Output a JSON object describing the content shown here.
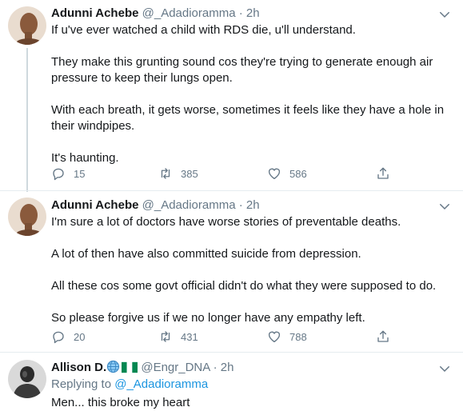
{
  "tweets": [
    {
      "name": "Adunni Achebe",
      "handle": "@_Adadioramma",
      "dot": "·",
      "time": "2h",
      "paragraphs": [
        "If u've ever watched a child with RDS die, u'll understand.",
        "They make this grunting sound cos they're trying to generate enough air pressure to keep their lungs open.",
        "With each breath, it gets worse, sometimes it feels like they have a hole in their windpipes.",
        "It's haunting."
      ],
      "replies": "15",
      "retweets": "385",
      "likes": "586"
    },
    {
      "name": "Adunni Achebe",
      "handle": "@_Adadioramma",
      "dot": "·",
      "time": "2h",
      "paragraphs": [
        "I'm sure a lot of doctors have worse stories of preventable deaths.",
        "A lot of then have also committed suicide from depression.",
        "All these cos some govt official didn't do what they were supposed to do.",
        "So please forgive us if we no longer have any empathy left."
      ],
      "replies": "20",
      "retweets": "431",
      "likes": "788"
    },
    {
      "name": "Allison D.",
      "handle": "@Engr_DNA",
      "dot": "·",
      "time": "2h",
      "replying_prefix": "Replying to",
      "replying_to": "@_Adadioramma",
      "text": "Men... this broke my heart"
    }
  ],
  "colors": {
    "accent": "#1b95e0",
    "secondary_text": "#657786",
    "primary_text": "#14171a",
    "divider": "#e6ecf0"
  },
  "icons": [
    "chevron-down-icon",
    "reply-icon",
    "retweet-icon",
    "like-icon",
    "share-icon",
    "globe-icon",
    "nigeria-flag-icon"
  ]
}
